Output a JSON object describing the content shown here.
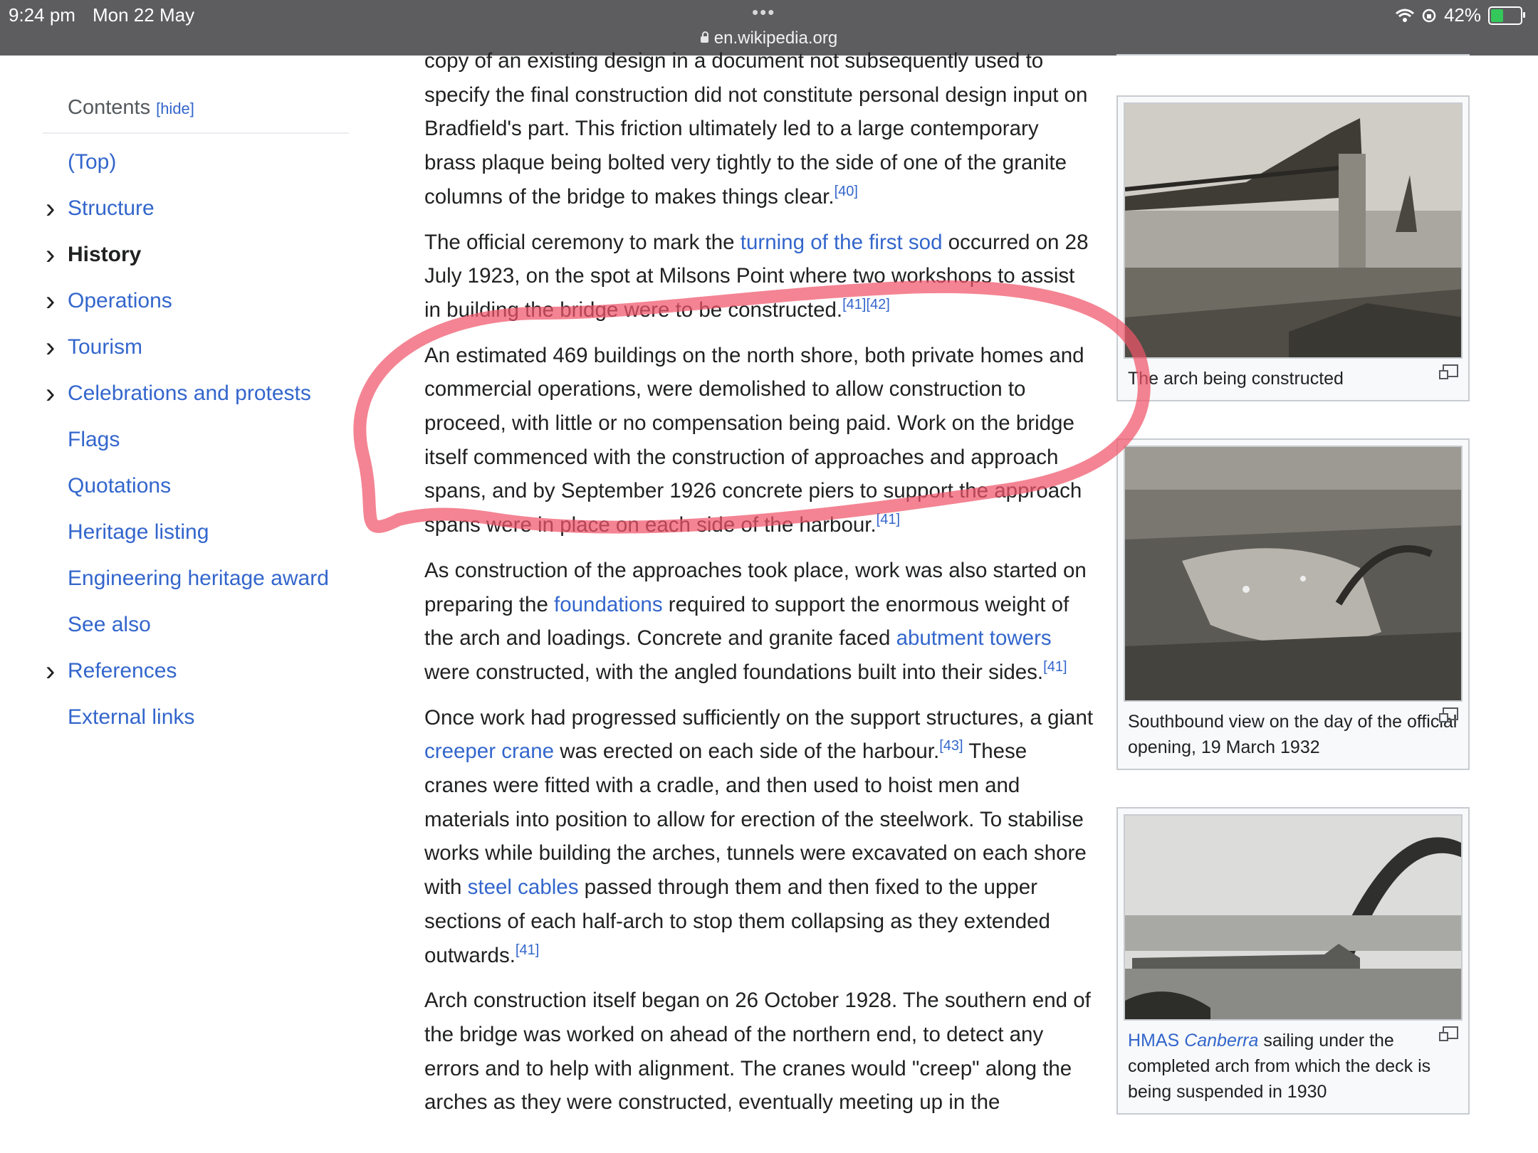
{
  "status_bar": {
    "time": "9:24 pm",
    "date": "Mon 22 May",
    "url": "en.wikipedia.org",
    "battery": "42%",
    "battery_level": 0.42
  },
  "toc": {
    "title": "Contents",
    "hide_label": "[hide]",
    "items": [
      {
        "label": "(Top)",
        "chevron": false,
        "active": false
      },
      {
        "label": "Structure",
        "chevron": true,
        "active": false
      },
      {
        "label": "History",
        "chevron": true,
        "active": true
      },
      {
        "label": "Operations",
        "chevron": true,
        "active": false
      },
      {
        "label": "Tourism",
        "chevron": true,
        "active": false
      },
      {
        "label": "Celebrations and protests",
        "chevron": true,
        "active": false
      },
      {
        "label": "Flags",
        "chevron": false,
        "active": false
      },
      {
        "label": "Quotations",
        "chevron": false,
        "active": false
      },
      {
        "label": "Heritage listing",
        "chevron": false,
        "active": false
      },
      {
        "label": "Engineering heritage award",
        "chevron": false,
        "active": false
      },
      {
        "label": "See also",
        "chevron": false,
        "active": false
      },
      {
        "label": "References",
        "chevron": true,
        "active": false
      },
      {
        "label": "External links",
        "chevron": false,
        "active": false
      }
    ]
  },
  "article": {
    "p1": {
      "text": "copy of an existing design in a document not subsequently used to specify the final construction did not constitute personal design input on Bradfield's part. This friction ultimately led to a large contemporary brass plaque being bolted very tightly to the side of one of the granite columns of the bridge to makes things clear.",
      "ref": "[40]"
    },
    "p2": {
      "t1": "The official ceremony to mark the ",
      "link1": "turning of the first sod",
      "t2": " occurred on 28 July 1923, on the spot at Milsons Point where two workshops to assist in building the bridge were to be constructed.",
      "ref": "[41][42]"
    },
    "p3": {
      "text": "An estimated 469 buildings on the north shore, both private homes and commercial operations, were demolished to allow construction to proceed, with little or no compensation being paid. Work on the bridge itself commenced with the construction of approaches and approach spans, and by September 1926 concrete piers to support the approach spans were in place on each side of the harbour.",
      "ref": "[41]"
    },
    "p4": {
      "t1": "As construction of the approaches took place, work was also started on preparing the ",
      "link1": "foundations",
      "t2": " required to support the enormous weight of the arch and loadings. Concrete and granite faced ",
      "link2": "abutment towers",
      "t3": " were constructed, with the angled foundations built into their sides.",
      "ref": "[41]"
    },
    "p5": {
      "t1": "Once work had progressed sufficiently on the support structures, a giant ",
      "link1": "creeper crane",
      "t2": " was erected on each side of the harbour.",
      "ref1": "[43]",
      "t3": " These cranes were fitted with a cradle, and then used to hoist men and materials into position to allow for erection of the steelwork. To stabilise works while building the arches, tunnels were excavated on each shore with ",
      "link2": "steel cables",
      "t4": " passed through them and then fixed to the upper sections of each half-arch to stop them collapsing as they extended outwards.",
      "ref2": "[41]"
    },
    "p6": {
      "text": "Arch construction itself began on 26 October 1928. The southern end of the bridge was worked on ahead of the northern end, to detect any errors and to help with alignment. The cranes would \"creep\" along the arches as they were constructed, eventually meeting up in the"
    }
  },
  "figures": [
    {
      "caption": "The arch being constructed"
    },
    {
      "caption": "Southbound view on the day of the official opening, 19 March 1932"
    },
    {
      "caption_link": "HMAS ",
      "caption_link_italic": "Canberra",
      "caption_rest": " sailing under the completed arch from which the deck is being suspended in 1930"
    }
  ],
  "colors": {
    "link": "#3366cc",
    "marker": "#f0556a",
    "status_bar": "#5d5d60"
  }
}
